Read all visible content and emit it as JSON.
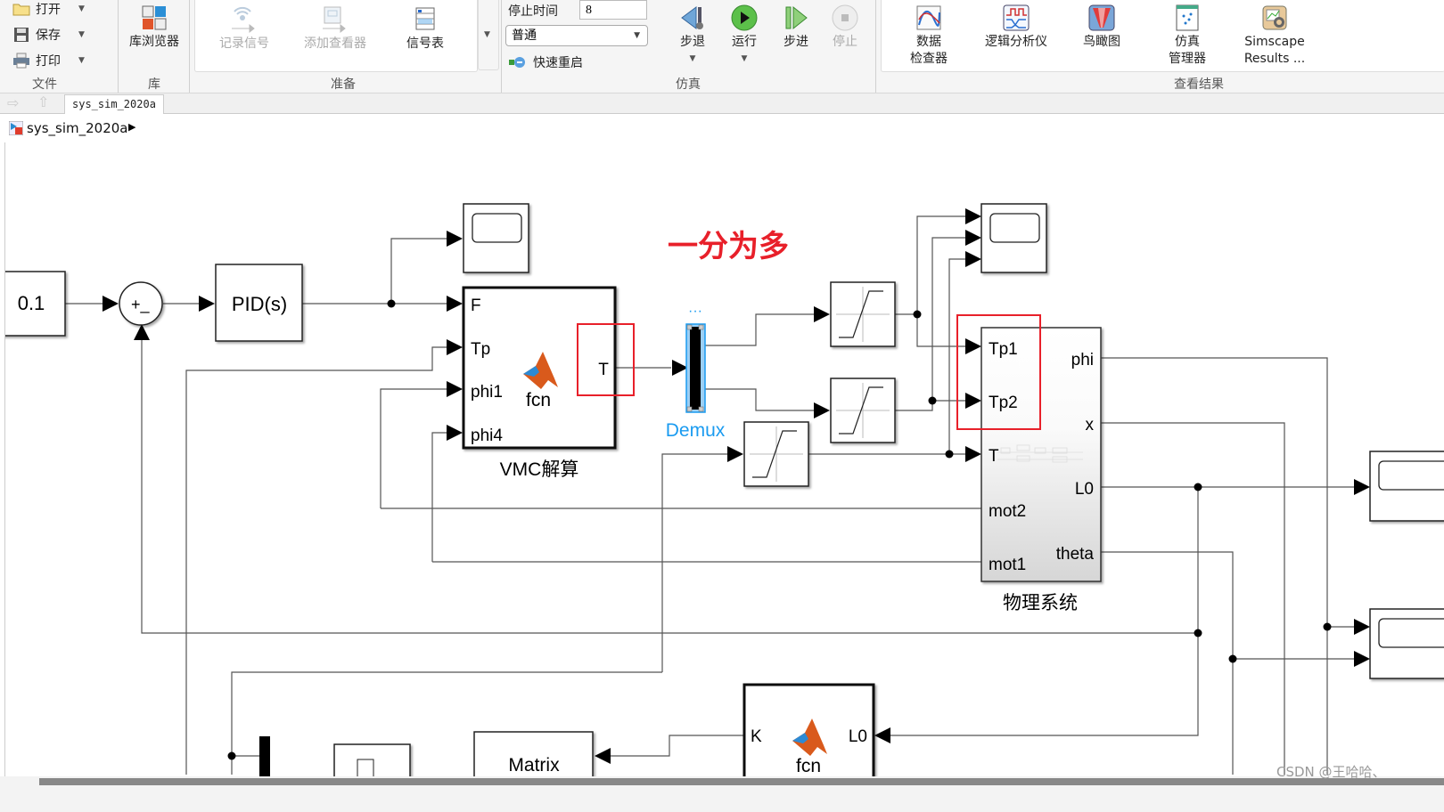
{
  "toolstrip": {
    "file": {
      "label": "文件",
      "open": "打开",
      "save": "保存",
      "print": "打印",
      "dropdown_glyph": "▼"
    },
    "library": {
      "label": "库",
      "browser": "库浏览器"
    },
    "prepare": {
      "label": "准备",
      "log_signals": "记录信号",
      "add_viewer": "添加查看器",
      "signal_table": "信号表",
      "expand_glyph": "▼"
    },
    "simulate": {
      "label": "仿真",
      "stop_time_label": "停止时间",
      "stop_time_value": "8",
      "mode_value": "普通",
      "fast_restart": "快速重启",
      "step_back": "步退",
      "run": "运行",
      "step_forward": "步进",
      "stop": "停止"
    },
    "review": {
      "label": "查看结果",
      "data_inspector_line1": "数据",
      "data_inspector_line2": "检查器",
      "logic_analyzer": "逻辑分析仪",
      "birds_eye": "鸟瞰图",
      "sim_manager_line1": "仿真",
      "sim_manager_line2": "管理器",
      "simscape_line1": "Simscape",
      "simscape_line2": "Results ..."
    }
  },
  "nav": {
    "tab_label": "sys_sim_2020a",
    "breadcrumb_model": "sys_sim_2020a",
    "breadcrumb_arrow": "▶"
  },
  "diagram": {
    "annotation": "一分为多",
    "annotation_color": "#e8202a",
    "highlight_color": "#e8202a",
    "selection_color": "#1a9bf0",
    "constant_value": "0.1",
    "sum_signs": "+_",
    "pid_label": "PID(s)",
    "vmc_block": {
      "name": "VMC解算",
      "inputs": [
        "F",
        "Tp",
        "phi1",
        "phi4"
      ],
      "output": "T",
      "function": "fcn"
    },
    "demux": {
      "name": "Demux",
      "dots": "···"
    },
    "physical_system": {
      "name": "物理系统",
      "inputs": [
        "Tp1",
        "Tp2",
        "T",
        "mot2",
        "mot1"
      ],
      "outputs": [
        "phi",
        "x",
        "L0",
        "theta"
      ]
    },
    "lqr_block": {
      "input": "L0",
      "output": "K",
      "function": "fcn"
    },
    "matrix_label": "Matrix"
  },
  "watermark": "CSDN @王哈哈、"
}
